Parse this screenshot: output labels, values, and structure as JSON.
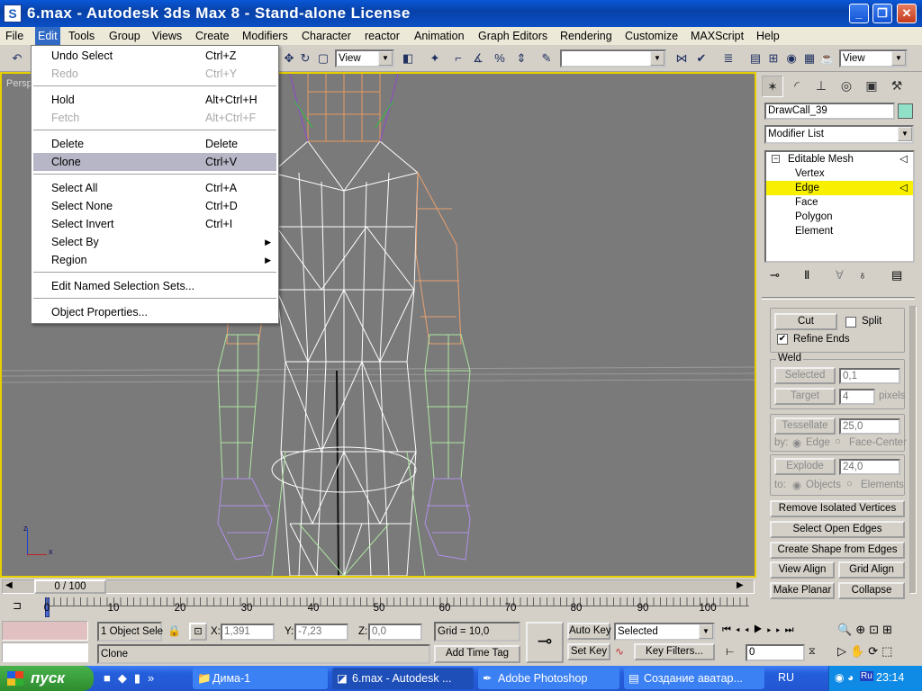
{
  "window": {
    "title": "6.max - Autodesk 3ds Max 8  - Stand-alone License",
    "app_icon": "S",
    "min": "_",
    "max": "❐",
    "close": "✕"
  },
  "menubar": [
    "File",
    "Edit",
    "Tools",
    "Group",
    "Views",
    "Create",
    "Modifiers",
    "Character",
    "reactor",
    "Animation",
    "Graph Editors",
    "Rendering",
    "Customize",
    "MAXScript",
    "Help"
  ],
  "toolbar": {
    "view_combo": "View",
    "sel_combo": "",
    "view_combo2": "View"
  },
  "edit_menu": [
    {
      "label": "Undo Select",
      "shortcut": "Ctrl+Z",
      "enabled": true
    },
    {
      "label": "Redo",
      "shortcut": "Ctrl+Y",
      "enabled": false
    },
    {
      "label": "Hold",
      "shortcut": "Alt+Ctrl+H",
      "enabled": true
    },
    {
      "label": "Fetch",
      "shortcut": "Alt+Ctrl+F",
      "enabled": false
    },
    {
      "label": "Delete",
      "shortcut": "Delete",
      "enabled": true
    },
    {
      "label": "Clone",
      "shortcut": "Ctrl+V",
      "enabled": true
    },
    {
      "label": "Select All",
      "shortcut": "Ctrl+A",
      "enabled": true
    },
    {
      "label": "Select None",
      "shortcut": "Ctrl+D",
      "enabled": true
    },
    {
      "label": "Select Invert",
      "shortcut": "Ctrl+I",
      "enabled": true
    },
    {
      "label": "Select By",
      "shortcut": "",
      "enabled": true
    },
    {
      "label": "Region",
      "shortcut": "",
      "enabled": true
    },
    {
      "label": "Edit Named Selection Sets...",
      "shortcut": "",
      "enabled": true
    },
    {
      "label": "Object Properties...",
      "shortcut": "",
      "enabled": true
    }
  ],
  "viewport": {
    "label": "Persp",
    "axis_z": "z",
    "axis_x": "x"
  },
  "command_panel": {
    "object_name": "DrawCall_39",
    "modifier_list": "Modifier List",
    "stack": [
      "Editable Mesh",
      "Vertex",
      "Edge",
      "Face",
      "Polygon",
      "Element"
    ],
    "cut": "Cut",
    "split": "Split",
    "refine_ends": "Refine Ends",
    "weld_label": "Weld",
    "selected": "Selected",
    "selected_val": "0,1",
    "target": "Target",
    "target_val": "4",
    "pixels": "pixels",
    "tessellate": "Tessellate",
    "tess_val": "25,0",
    "by": "by:",
    "edge": "Edge",
    "face_center": "Face-Center",
    "explode": "Explode",
    "explode_val": "24,0",
    "to": "to:",
    "objects": "Objects",
    "elements": "Elements",
    "remove_iso": "Remove Isolated Vertices",
    "select_open": "Select Open Edges",
    "create_shape": "Create Shape from Edges",
    "view_align": "View Align",
    "grid_align": "Grid Align",
    "make_planar": "Make Planar",
    "collapse": "Collapse"
  },
  "trackbar": {
    "frame": "0 / 100",
    "ticks": [
      "0",
      "10",
      "20",
      "30",
      "40",
      "50",
      "60",
      "70",
      "80",
      "90",
      "100"
    ]
  },
  "status": {
    "selected_info": "1 Object Sele",
    "x_label": "X:",
    "x_val": "1,391",
    "y_label": "Y:",
    "y_val": "-7,23",
    "z_label": "Z:",
    "z_val": "0,0",
    "grid": "Grid = 10,0",
    "auto_key": "Auto Key",
    "set_key": "Set Key",
    "key_combo": "Selected",
    "key_filters": "Key Filters...",
    "add_time_tag": "Add Time Tag",
    "prompt": "Clone",
    "frame": "0"
  },
  "taskbar": {
    "start": "пуск",
    "tasks": [
      "Дима-1",
      "6.max - Autodesk ...",
      "Adobe Photoshop",
      "Создание аватар..."
    ],
    "lang": "RU",
    "lang_icon": "Ru",
    "clock": "23:14"
  },
  "colors": {
    "viewport_bg": "#7a7a7a",
    "active_border": "#e8d000",
    "stack_highlight": "#f8f000",
    "wire_white": "#ffffff",
    "wire_green": "#aee6a0",
    "wire_orange": "#e8a070",
    "wire_purple": "#b090e8"
  }
}
